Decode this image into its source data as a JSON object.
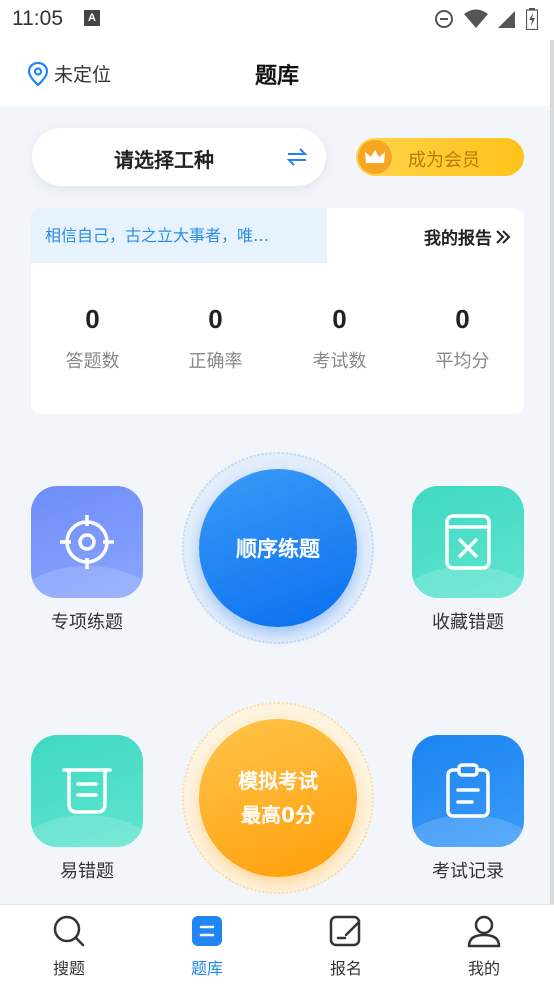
{
  "status": {
    "time": "11:05",
    "notif_badge": "A"
  },
  "header": {
    "location": "未定位",
    "title": "题库"
  },
  "job_selector": {
    "label": "请选择工种"
  },
  "vip_button": {
    "label": "成为会员"
  },
  "stats": {
    "motto": "相信自己，古之立大事者，唯…",
    "report_link": "我的报告",
    "items": [
      {
        "value": "0",
        "label": "答题数"
      },
      {
        "value": "0",
        "label": "正确率"
      },
      {
        "value": "0",
        "label": "考试数"
      },
      {
        "value": "0",
        "label": "平均分"
      }
    ]
  },
  "practice": {
    "special": "专项练题",
    "sequential": "顺序练题",
    "favorites": "收藏错题",
    "easy_wrong": "易错题",
    "mock_title": "模拟考试",
    "mock_best": "最高0分",
    "exam_record": "考试记录"
  },
  "tabbar": {
    "items": [
      {
        "label": "搜题",
        "icon": "search-icon"
      },
      {
        "label": "题库",
        "icon": "question-bank-icon"
      },
      {
        "label": "报名",
        "icon": "signup-icon"
      },
      {
        "label": "我的",
        "icon": "user-icon"
      }
    ],
    "active": "题库"
  },
  "colors": {
    "accent": "#1f86f2",
    "vip": "#ffc21a",
    "background": "#f2f6fa"
  }
}
